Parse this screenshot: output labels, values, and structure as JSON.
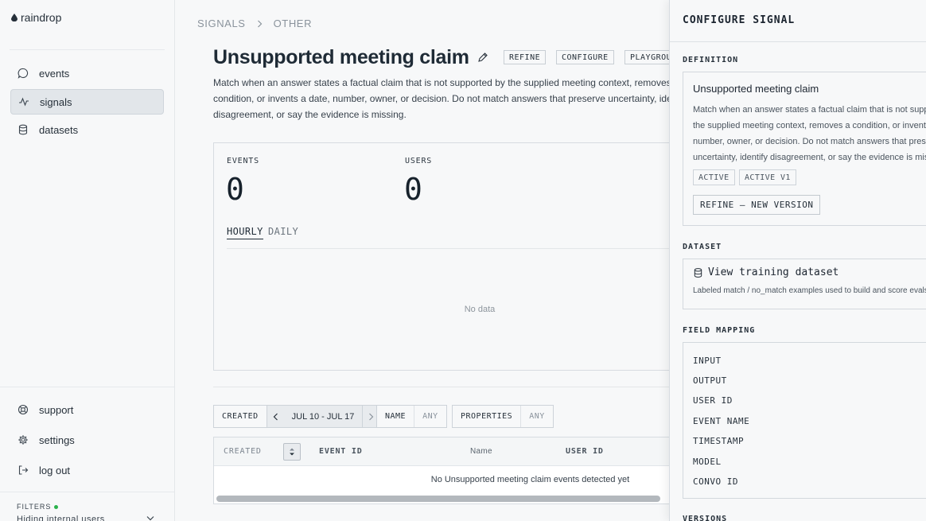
{
  "brand": {
    "name": "raindrop"
  },
  "sidebar": {
    "nav": [
      {
        "label": "events",
        "icon": "chat-bubble-icon"
      },
      {
        "label": "signals",
        "icon": "pulse-icon"
      },
      {
        "label": "datasets",
        "icon": "database-icon"
      }
    ],
    "bottom": [
      {
        "label": "support",
        "icon": "lifebuoy-icon"
      },
      {
        "label": "settings",
        "icon": "gear-icon"
      },
      {
        "label": "log out",
        "icon": "logout-icon"
      }
    ],
    "filters": {
      "label": "FILTERS",
      "value": "Hiding internal users"
    }
  },
  "breadcrumb": [
    "SIGNALS",
    "OTHER"
  ],
  "page": {
    "title": "Unsupported meeting claim",
    "actions": [
      "REFINE",
      "CONFIGURE",
      "PLAYGROUND"
    ],
    "description_lines": [
      "Match when an answer states a factual claim that is not supported by the supplied meeting context, removes a",
      "condition, or invents a date, number, owner, or decision. Do not match answers that preserve uncertainty, identify",
      "disagreement, or say the evidence is missing."
    ]
  },
  "stats": {
    "events_label": "EVENTS",
    "events_value": "0",
    "users_label": "USERS",
    "users_value": "0",
    "tabs": [
      "HOURLY",
      "DAILY"
    ],
    "active_tab": "HOURLY",
    "empty_text": "No data"
  },
  "filters_bar": {
    "created_label": "CREATED",
    "date_range": "JUL 10 - JUL 17",
    "name_label": "NAME",
    "name_value": "ANY",
    "properties_label": "PROPERTIES",
    "properties_value": "ANY"
  },
  "table": {
    "columns": [
      "CREATED",
      "EVENT ID",
      "Name",
      "USER ID"
    ],
    "empty_text": "No Unsupported meeting claim events detected yet"
  },
  "panel": {
    "title": "CONFIGURE SIGNAL",
    "definition": {
      "section_label": "DEFINITION",
      "name": "Unsupported meeting claim",
      "description_lines": [
        "Match when an answer states a factual claim that is not supported by",
        "the supplied meeting context, removes a condition, or invents a date,",
        "number, owner, or decision. Do not match answers that preserve",
        "uncertainty, identify disagreement, or say the evidence is missing."
      ],
      "badges": [
        "ACTIVE",
        "ACTIVE V1"
      ],
      "refine_button": "REFINE — NEW VERSION"
    },
    "dataset": {
      "section_label": "DATASET",
      "link": "View training dataset",
      "subtitle": "Labeled match / no_match examples used to build and score evals."
    },
    "field_mapping": {
      "section_label": "FIELD MAPPING",
      "fields": [
        "INPUT",
        "OUTPUT",
        "USER ID",
        "EVENT NAME",
        "TIMESTAMP",
        "MODEL",
        "CONVO ID"
      ]
    },
    "versions": {
      "section_label": "VERSIONS"
    }
  }
}
